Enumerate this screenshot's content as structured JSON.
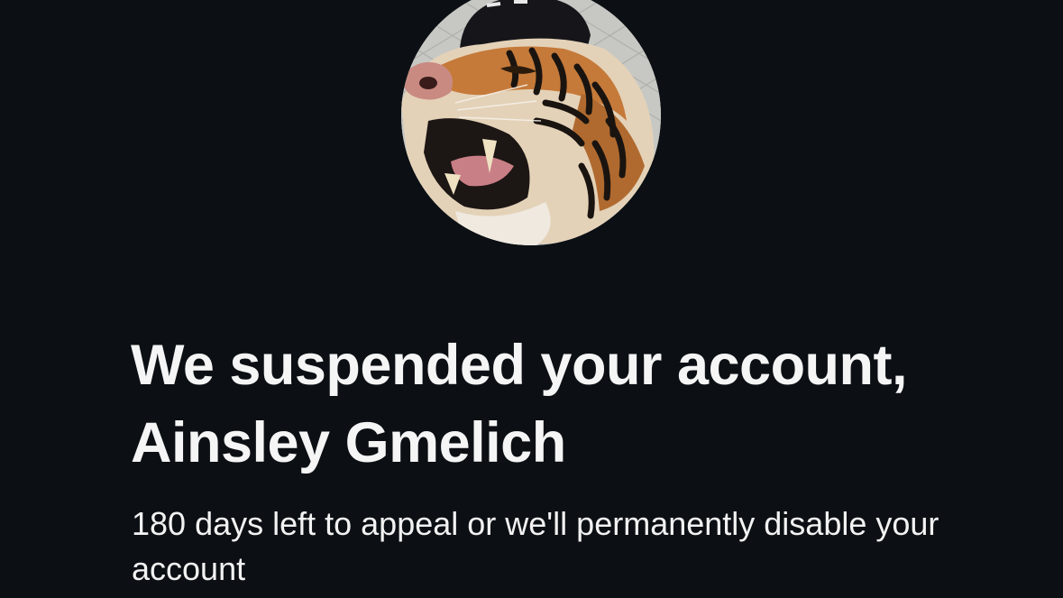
{
  "profile": {
    "avatar_icon": "tiger-profile-photo"
  },
  "suspension": {
    "headline": "We suspended your account, Ainsley Gmelich",
    "subtext": "180 days left to appeal or we'll permanently disable your account"
  },
  "colors": {
    "background": "#0c1014",
    "text": "#f5f5f5"
  }
}
